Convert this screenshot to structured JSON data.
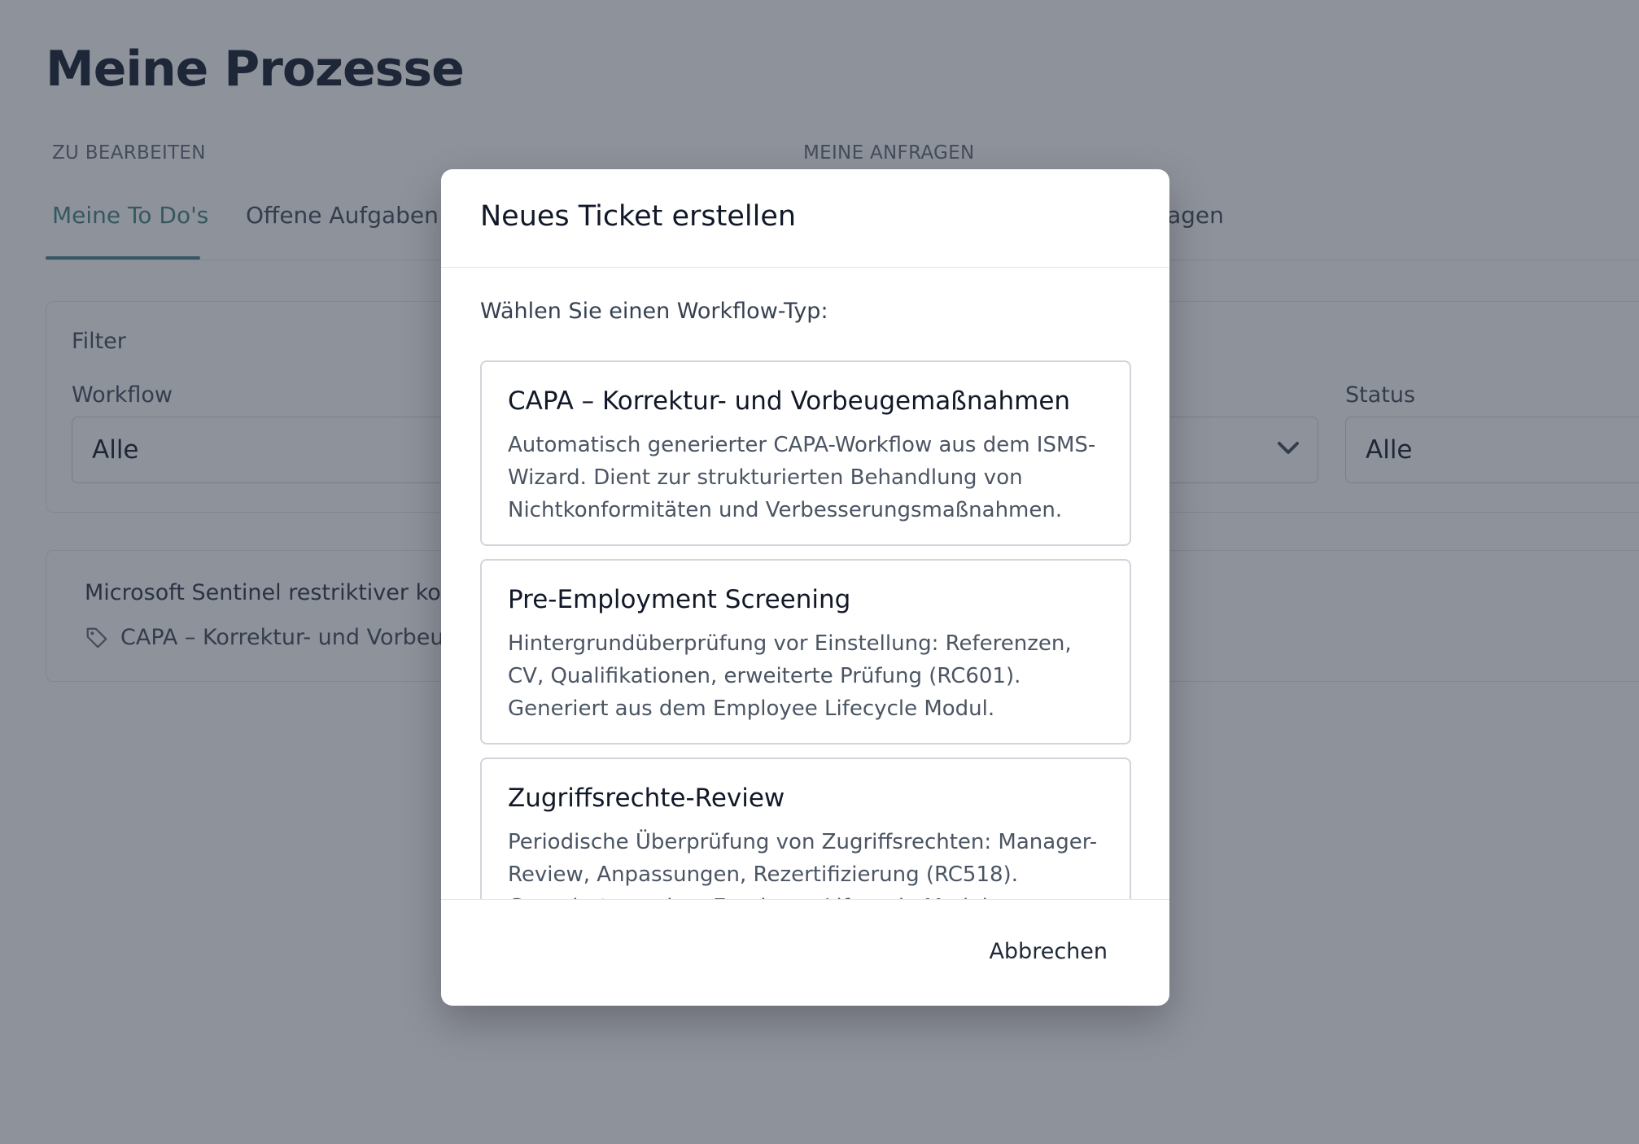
{
  "page": {
    "title": "Meine Prozesse",
    "section_edit": "ZU BEARBEITEN",
    "section_requests": "MEINE ANFRAGEN",
    "tabs": [
      {
        "label": "Meine To Do's",
        "active": true
      },
      {
        "label": "Offene Aufgaben",
        "active": false
      },
      {
        "label": "sene Anfragen",
        "active": false
      }
    ]
  },
  "filter": {
    "title": "Filter",
    "workflow_label": "Workflow",
    "workflow_value": "Alle",
    "status_label": "Status",
    "status_value": "Alle"
  },
  "ticket": {
    "title": "Microsoft Sentinel restriktiver konfig",
    "tag": "CAPA – Korrektur- und Vorbeug"
  },
  "modal": {
    "title": "Neues Ticket erstellen",
    "prompt": "Wählen Sie einen Workflow-Typ:",
    "options": [
      {
        "title": "CAPA – Korrektur- und Vorbeugemaßnahmen",
        "description": "Automatisch generierter CAPA-Workflow aus dem ISMS-Wizard. Dient zur strukturierten Behandlung von Nichtkonformitäten und Verbesserungsmaßnahmen."
      },
      {
        "title": "Pre-Employment Screening",
        "description": "Hintergrundüberprüfung vor Einstellung: Referenzen, CV, Qualifikationen, erweiterte Prüfung (RC601). Generiert aus dem Employee Lifecycle Modul."
      },
      {
        "title": "Zugriffsrechte-Review",
        "description": "Periodische Überprüfung von Zugriffsrechten: Manager-Review, Anpassungen, Rezertifizierung (RC518). Generiert aus dem Employee Lifecycle Modul."
      }
    ],
    "cancel_label": "Abbrechen"
  },
  "colors": {
    "accent": "#4f8a8b",
    "overlay": "#1e2638"
  },
  "icons": {
    "tag": "tag-icon",
    "dropdown": "chevron-down-icon"
  }
}
